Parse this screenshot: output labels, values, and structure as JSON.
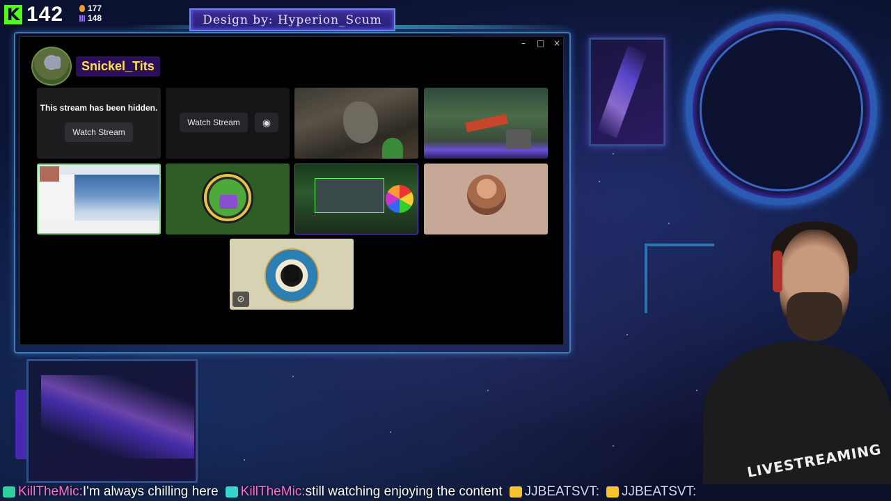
{
  "overlay": {
    "kick_count": "142",
    "followers_stat": "177",
    "viewers_stat": "148",
    "design_credit": "Design by: Hyperion_Scum"
  },
  "window": {
    "controls": {
      "minimize": "–",
      "maximize": "□",
      "close": "×"
    },
    "streamer": {
      "name": "Snickel_Tits"
    },
    "tiles": {
      "hidden_message": "This stream has been hidden.",
      "watch_label_1": "Watch Stream",
      "watch_label_2": "Watch Stream"
    }
  },
  "webcam": {
    "shirt_text": "LIVESTREAMING"
  },
  "chat_ticker": {
    "messages": [
      {
        "user": "KillTheMic:",
        "text": "I'm always chilling here"
      },
      {
        "user": "KillTheMic:",
        "text": "still watching enjoying the content"
      },
      {
        "user": "JJBEATSVT:",
        "text": ""
      },
      {
        "user": "JJBEATSVT:",
        "text": ""
      }
    ]
  },
  "colors": {
    "kick_green": "#53fc18",
    "accent_purple": "#6a45c9",
    "streamer_name": "#ffe14a"
  },
  "icons": [
    "kick-logo-icon",
    "fire-icon",
    "bars-icon",
    "eye-icon",
    "mute-icon"
  ]
}
